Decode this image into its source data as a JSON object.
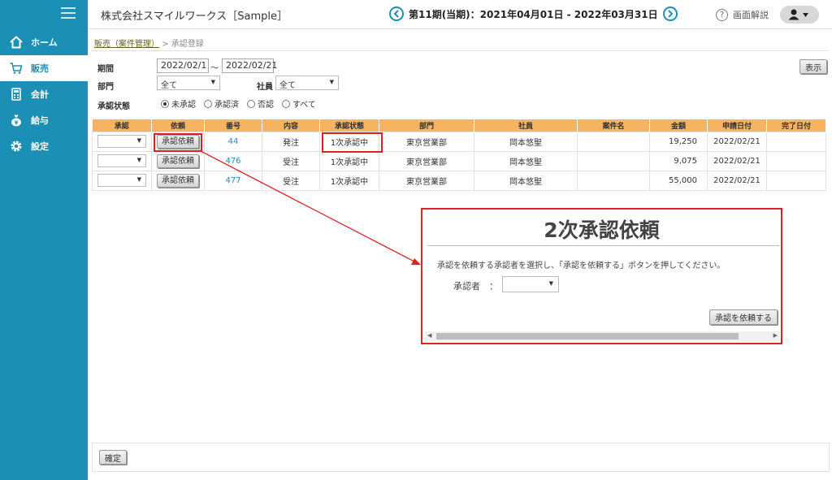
{
  "sidebar": {
    "items": [
      {
        "label": "ホーム",
        "icon": "home-icon"
      },
      {
        "label": "販売",
        "icon": "cart-icon"
      },
      {
        "label": "会計",
        "icon": "calculator-icon"
      },
      {
        "label": "給与",
        "icon": "money-bag-icon"
      },
      {
        "label": "設定",
        "icon": "gear-icon"
      }
    ],
    "active_index": 1
  },
  "header": {
    "company": "株式会社スマイルワークス［Sample］",
    "period": "第11期(当期)：2021年04月01日 - 2022年03月31日",
    "help_label": "画面解説"
  },
  "breadcrumb": {
    "parent": "販売（案件管理）",
    "separator": ">",
    "current": "承認登録"
  },
  "filters": {
    "period_label": "期間",
    "date_from": "2022/02/1",
    "date_sep": "～",
    "date_to": "2022/02/21",
    "dept_label": "部門",
    "dept_value": "全て",
    "employee_label": "社員",
    "employee_value": "全て",
    "status_label": "承認状態",
    "status_options": [
      "未承認",
      "承認済",
      "否認",
      "すべて"
    ],
    "status_selected": 0,
    "show_button": "表示"
  },
  "table": {
    "columns": [
      "承認",
      "依頼",
      "番号",
      "内容",
      "承認状態",
      "部門",
      "社員",
      "案件名",
      "金額",
      "申請日付",
      "完了日付"
    ],
    "request_button": "承認依頼",
    "rows": [
      {
        "number": "44",
        "content": "発注",
        "status": "1次承認中",
        "dept": "東京営業部",
        "employee": "岡本悠聖",
        "case": "",
        "amount": "19,250",
        "applied": "2022/02/21",
        "completed": ""
      },
      {
        "number": "476",
        "content": "受注",
        "status": "1次承認中",
        "dept": "東京営業部",
        "employee": "岡本悠聖",
        "case": "",
        "amount": "9,075",
        "applied": "2022/02/21",
        "completed": ""
      },
      {
        "number": "477",
        "content": "受注",
        "status": "1次承認中",
        "dept": "東京営業部",
        "employee": "岡本悠聖",
        "case": "",
        "amount": "55,000",
        "applied": "2022/02/21",
        "completed": ""
      }
    ]
  },
  "dialog": {
    "title": "2次承認依頼",
    "message": "承認を依頼する承認者を選択し、「承認を依頼する」ボタンを押してください。",
    "approver_label": "承認者　：",
    "submit_button": "承認を依頼する"
  },
  "footer": {
    "confirm_button": "確定"
  },
  "colors": {
    "sidebar": "#1b8fb5",
    "table_header": "#f7b35f",
    "highlight": "#e02020",
    "link": "#1b8fb5"
  }
}
